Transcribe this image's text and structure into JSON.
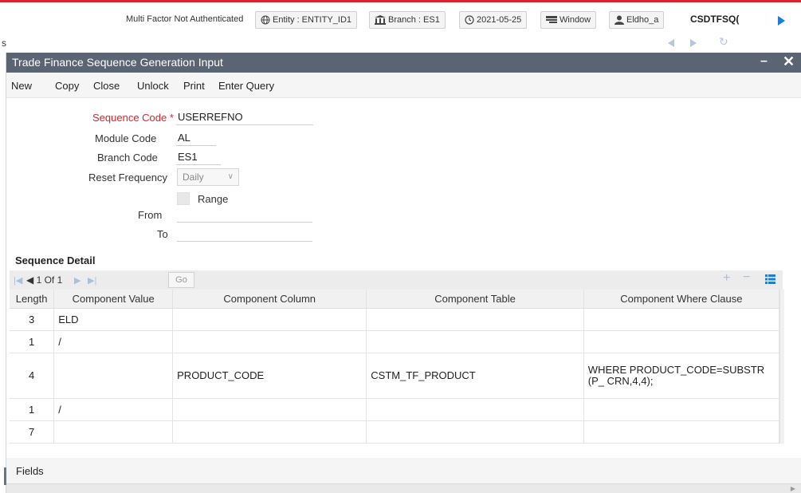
{
  "topbar": {
    "auth_status": "Multi Factor Not Authenticated",
    "entity": "Entity : ENTITY_ID1",
    "branch": "Branch : ES1",
    "date": "2021-05-25",
    "window": "Window",
    "user": "Eldho_a",
    "function_id": "CSDTFSQ("
  },
  "subbar": {
    "label": "s"
  },
  "window": {
    "title": "Trade Finance Sequence Generation Input",
    "menu": [
      "New",
      "Copy",
      "Close",
      "Unlock",
      "Print",
      "Enter Query"
    ]
  },
  "form": {
    "sequence_code_label": "Sequence Code",
    "required_mark": "*",
    "sequence_code_value": "USERREFNO",
    "module_code_label": "Module Code",
    "module_code_value": "AL",
    "branch_code_label": "Branch Code",
    "branch_code_value": "ES1",
    "reset_frequency_label": "Reset Frequency",
    "reset_frequency_value": "Daily",
    "range_label": "Range",
    "from_label": "From",
    "from_value": "",
    "to_label": "To",
    "to_value": ""
  },
  "sequence_detail": {
    "title": "Sequence Detail",
    "pager": "1 Of 1",
    "go_label": "Go",
    "columns": [
      "Length",
      "Component Value",
      "Component Column",
      "Component Table",
      "Component Where Clause"
    ],
    "rows": [
      [
        "3",
        "ELD",
        "",
        "",
        ""
      ],
      [
        "1",
        "/",
        "",
        "",
        ""
      ],
      [
        "4",
        "",
        "PRODUCT_CODE",
        "CSTM_TF_PRODUCT",
        "WHERE PRODUCT_CODE=SUBSTR(P_ CRN,4,4);"
      ],
      [
        "1",
        "/",
        "",
        "",
        ""
      ],
      [
        "7",
        "",
        "",
        "",
        ""
      ]
    ]
  },
  "footer": {
    "fields_label": "Fields"
  },
  "colors": {
    "accent_red": "#d9232d",
    "title_bar": "#5a6472",
    "nav_blue": "#1a7fd4",
    "disabled_icon": "#a9bfdc"
  }
}
